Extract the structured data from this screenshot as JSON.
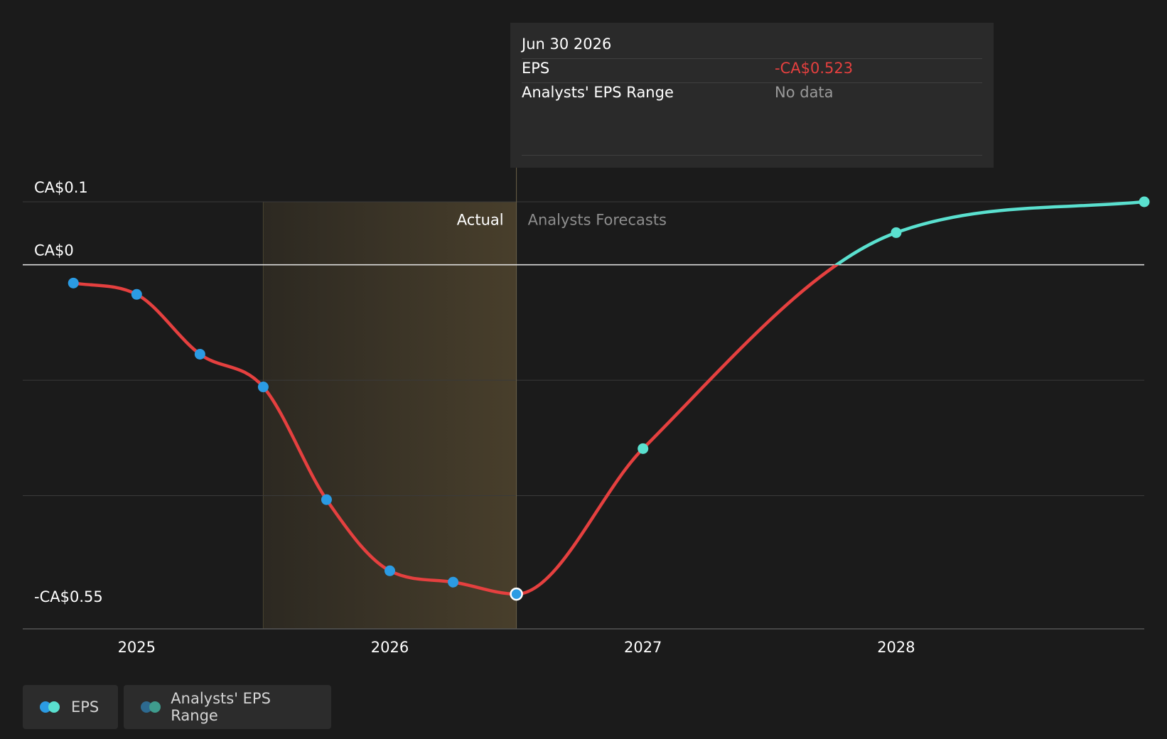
{
  "tooltip": {
    "date": "Jun 30 2026",
    "rows": [
      {
        "label": "EPS",
        "value": "-CA$0.523",
        "color": "#e5403f"
      },
      {
        "label": "Analysts' EPS Range",
        "value": "No data",
        "color": "#9a9a9a"
      }
    ]
  },
  "legend": [
    {
      "label": "EPS",
      "colors": [
        "#2b9be3",
        "#5ae0cf"
      ]
    },
    {
      "label": "Analysts' EPS Range",
      "colors": [
        "#2d6a90",
        "#3f9c8d"
      ]
    }
  ],
  "chart_data": {
    "type": "line",
    "x_ticks": [
      2025,
      2026,
      2027,
      2028
    ],
    "y_labels": [
      {
        "value": 0.1,
        "text": "CA$0.1"
      },
      {
        "value": 0,
        "text": "CA$0"
      },
      {
        "value": -0.55,
        "text": "-CA$0.55"
      }
    ],
    "xlim": [
      2024.55,
      2028.98
    ],
    "ylim": [
      -0.55,
      0.1
    ],
    "region_labels": {
      "actual": "Actual",
      "forecast": "Analysts Forecasts"
    },
    "highlight_range": [
      2025.5,
      2026.5
    ],
    "forecast_start": 2026.5,
    "series": [
      {
        "name": "EPS",
        "colors": {
          "negative_line": "#e5403f",
          "positive_line": "#5ae0cf",
          "actual_point": "#2b9be3",
          "forecast_point": "#5ae0cf"
        },
        "points": [
          {
            "x": 2024.75,
            "y": -0.029,
            "kind": "actual"
          },
          {
            "x": 2025.0,
            "y": -0.047,
            "kind": "actual"
          },
          {
            "x": 2025.25,
            "y": -0.142,
            "kind": "actual"
          },
          {
            "x": 2025.5,
            "y": -0.194,
            "kind": "actual"
          },
          {
            "x": 2025.75,
            "y": -0.373,
            "kind": "actual"
          },
          {
            "x": 2026.0,
            "y": -0.486,
            "kind": "actual"
          },
          {
            "x": 2026.25,
            "y": -0.504,
            "kind": "actual"
          },
          {
            "x": 2026.5,
            "y": -0.523,
            "kind": "actual"
          },
          {
            "x": 2027.0,
            "y": -0.292,
            "kind": "forecast"
          },
          {
            "x": 2028.0,
            "y": 0.051,
            "kind": "forecast"
          },
          {
            "x": 2028.98,
            "y": 0.1,
            "kind": "forecast"
          }
        ]
      }
    ]
  }
}
